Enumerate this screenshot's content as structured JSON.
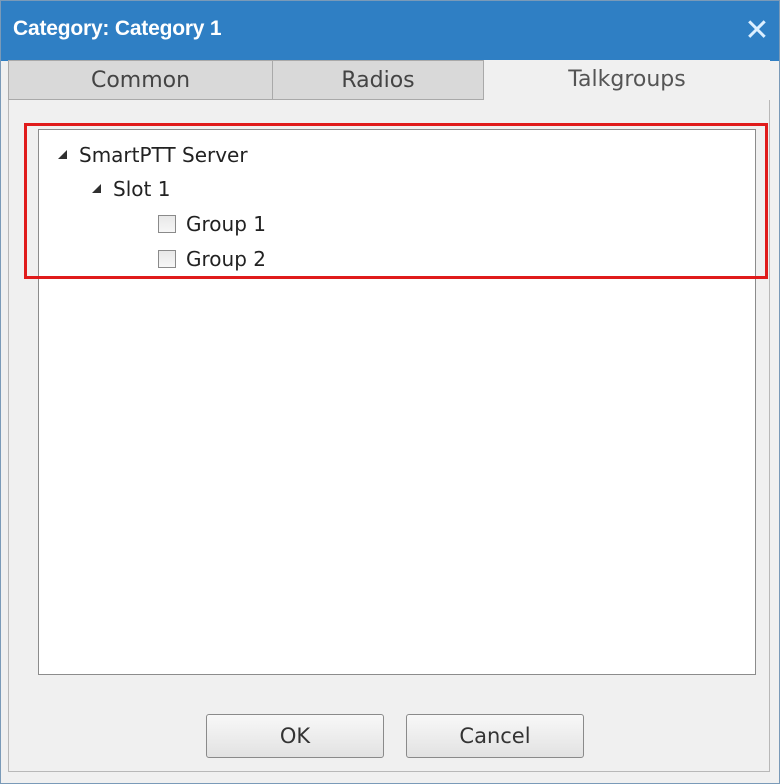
{
  "window": {
    "title": "Category: Category 1",
    "close_symbol": "✕"
  },
  "tabs": [
    {
      "label": "Common",
      "active": false
    },
    {
      "label": "Radios",
      "active": false
    },
    {
      "label": "Talkgroups",
      "active": true
    }
  ],
  "tree": {
    "root": {
      "label": "SmartPTT Server",
      "expanded": true,
      "children": [
        {
          "label": "Slot 1",
          "expanded": true,
          "children": [
            {
              "label": "Group 1",
              "checked": false
            },
            {
              "label": "Group 2",
              "checked": false
            }
          ]
        }
      ]
    }
  },
  "buttons": {
    "ok_label": "OK",
    "cancel_label": "Cancel"
  },
  "colors": {
    "titlebar": "#2f7fc4",
    "highlight": "#e01b1b"
  },
  "icons": {
    "close": "close-icon",
    "expander": "expanded-triangle-icon"
  }
}
